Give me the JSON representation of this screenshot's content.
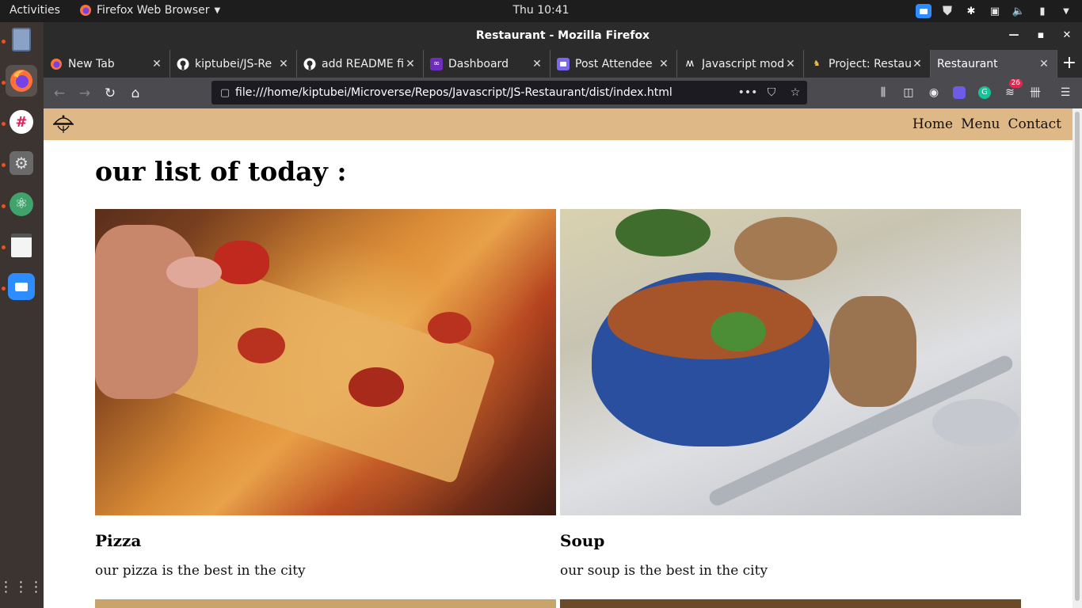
{
  "desktop": {
    "activities": "Activities",
    "app_menu": "Firefox Web Browser",
    "clock": "Thu 10:41"
  },
  "window": {
    "title": "Restaurant - Mozilla Firefox"
  },
  "tabs": [
    {
      "label": "New Tab",
      "icon": "firefox-icon"
    },
    {
      "label": "kiptubei/JS-Re",
      "icon": "github-icon"
    },
    {
      "label": "add README fi",
      "icon": "github-icon"
    },
    {
      "label": "Dashboard",
      "icon": "dashboard-icon"
    },
    {
      "label": "Post Attendee",
      "icon": "zoom-icon"
    },
    {
      "label": "Javascript mod",
      "icon": "microverse-icon"
    },
    {
      "label": "Project: Restau",
      "icon": "project-icon"
    },
    {
      "label": "Restaurant",
      "icon": "none"
    }
  ],
  "navbar": {
    "url": "file:///home/kiptubei/Microverse/Repos/Javascript/JS-Restaurant/dist/index.html",
    "notifications_badge": "26"
  },
  "site": {
    "nav_links": [
      "Home",
      "Menu",
      "Contact"
    ],
    "title": "our list of today :",
    "items": [
      {
        "name": "Pizza",
        "description": "our pizza is the best in the city"
      },
      {
        "name": "Soup",
        "description": "our soup is the best in the city"
      }
    ]
  },
  "colors": {
    "site_nav": "#deb887",
    "ubuntu_accent": "#e95420",
    "selected_tab": "#4a4a4f"
  }
}
